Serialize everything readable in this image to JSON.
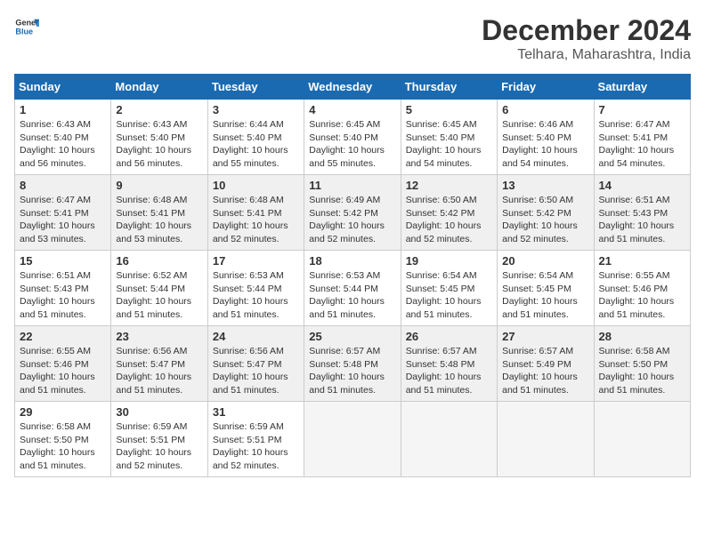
{
  "logo": {
    "line1": "General",
    "line2": "Blue"
  },
  "title": "December 2024",
  "location": "Telhara, Maharashtra, India",
  "days_of_week": [
    "Sunday",
    "Monday",
    "Tuesday",
    "Wednesday",
    "Thursday",
    "Friday",
    "Saturday"
  ],
  "weeks": [
    {
      "shaded": false,
      "days": [
        {
          "num": "1",
          "info": "Sunrise: 6:43 AM\nSunset: 5:40 PM\nDaylight: 10 hours\nand 56 minutes."
        },
        {
          "num": "2",
          "info": "Sunrise: 6:43 AM\nSunset: 5:40 PM\nDaylight: 10 hours\nand 56 minutes."
        },
        {
          "num": "3",
          "info": "Sunrise: 6:44 AM\nSunset: 5:40 PM\nDaylight: 10 hours\nand 55 minutes."
        },
        {
          "num": "4",
          "info": "Sunrise: 6:45 AM\nSunset: 5:40 PM\nDaylight: 10 hours\nand 55 minutes."
        },
        {
          "num": "5",
          "info": "Sunrise: 6:45 AM\nSunset: 5:40 PM\nDaylight: 10 hours\nand 54 minutes."
        },
        {
          "num": "6",
          "info": "Sunrise: 6:46 AM\nSunset: 5:40 PM\nDaylight: 10 hours\nand 54 minutes."
        },
        {
          "num": "7",
          "info": "Sunrise: 6:47 AM\nSunset: 5:41 PM\nDaylight: 10 hours\nand 54 minutes."
        }
      ]
    },
    {
      "shaded": true,
      "days": [
        {
          "num": "8",
          "info": "Sunrise: 6:47 AM\nSunset: 5:41 PM\nDaylight: 10 hours\nand 53 minutes."
        },
        {
          "num": "9",
          "info": "Sunrise: 6:48 AM\nSunset: 5:41 PM\nDaylight: 10 hours\nand 53 minutes."
        },
        {
          "num": "10",
          "info": "Sunrise: 6:48 AM\nSunset: 5:41 PM\nDaylight: 10 hours\nand 52 minutes."
        },
        {
          "num": "11",
          "info": "Sunrise: 6:49 AM\nSunset: 5:42 PM\nDaylight: 10 hours\nand 52 minutes."
        },
        {
          "num": "12",
          "info": "Sunrise: 6:50 AM\nSunset: 5:42 PM\nDaylight: 10 hours\nand 52 minutes."
        },
        {
          "num": "13",
          "info": "Sunrise: 6:50 AM\nSunset: 5:42 PM\nDaylight: 10 hours\nand 52 minutes."
        },
        {
          "num": "14",
          "info": "Sunrise: 6:51 AM\nSunset: 5:43 PM\nDaylight: 10 hours\nand 51 minutes."
        }
      ]
    },
    {
      "shaded": false,
      "days": [
        {
          "num": "15",
          "info": "Sunrise: 6:51 AM\nSunset: 5:43 PM\nDaylight: 10 hours\nand 51 minutes."
        },
        {
          "num": "16",
          "info": "Sunrise: 6:52 AM\nSunset: 5:44 PM\nDaylight: 10 hours\nand 51 minutes."
        },
        {
          "num": "17",
          "info": "Sunrise: 6:53 AM\nSunset: 5:44 PM\nDaylight: 10 hours\nand 51 minutes."
        },
        {
          "num": "18",
          "info": "Sunrise: 6:53 AM\nSunset: 5:44 PM\nDaylight: 10 hours\nand 51 minutes."
        },
        {
          "num": "19",
          "info": "Sunrise: 6:54 AM\nSunset: 5:45 PM\nDaylight: 10 hours\nand 51 minutes."
        },
        {
          "num": "20",
          "info": "Sunrise: 6:54 AM\nSunset: 5:45 PM\nDaylight: 10 hours\nand 51 minutes."
        },
        {
          "num": "21",
          "info": "Sunrise: 6:55 AM\nSunset: 5:46 PM\nDaylight: 10 hours\nand 51 minutes."
        }
      ]
    },
    {
      "shaded": true,
      "days": [
        {
          "num": "22",
          "info": "Sunrise: 6:55 AM\nSunset: 5:46 PM\nDaylight: 10 hours\nand 51 minutes."
        },
        {
          "num": "23",
          "info": "Sunrise: 6:56 AM\nSunset: 5:47 PM\nDaylight: 10 hours\nand 51 minutes."
        },
        {
          "num": "24",
          "info": "Sunrise: 6:56 AM\nSunset: 5:47 PM\nDaylight: 10 hours\nand 51 minutes."
        },
        {
          "num": "25",
          "info": "Sunrise: 6:57 AM\nSunset: 5:48 PM\nDaylight: 10 hours\nand 51 minutes."
        },
        {
          "num": "26",
          "info": "Sunrise: 6:57 AM\nSunset: 5:48 PM\nDaylight: 10 hours\nand 51 minutes."
        },
        {
          "num": "27",
          "info": "Sunrise: 6:57 AM\nSunset: 5:49 PM\nDaylight: 10 hours\nand 51 minutes."
        },
        {
          "num": "28",
          "info": "Sunrise: 6:58 AM\nSunset: 5:50 PM\nDaylight: 10 hours\nand 51 minutes."
        }
      ]
    },
    {
      "shaded": false,
      "days": [
        {
          "num": "29",
          "info": "Sunrise: 6:58 AM\nSunset: 5:50 PM\nDaylight: 10 hours\nand 51 minutes."
        },
        {
          "num": "30",
          "info": "Sunrise: 6:59 AM\nSunset: 5:51 PM\nDaylight: 10 hours\nand 52 minutes."
        },
        {
          "num": "31",
          "info": "Sunrise: 6:59 AM\nSunset: 5:51 PM\nDaylight: 10 hours\nand 52 minutes."
        },
        null,
        null,
        null,
        null
      ]
    }
  ]
}
